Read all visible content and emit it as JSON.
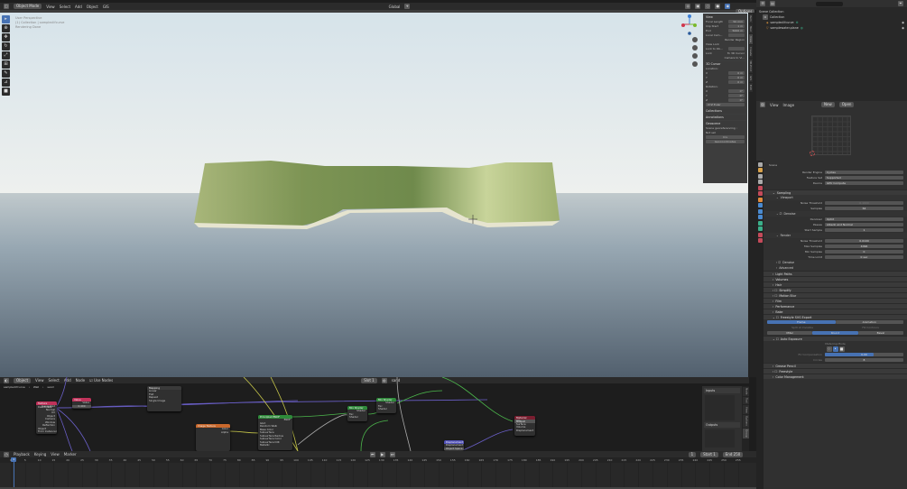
{
  "top_header": {
    "editor_icon": "3d-viewport-icon",
    "mode": "Object Mode",
    "menus": [
      "View",
      "Select",
      "Add",
      "Object",
      "GIS"
    ],
    "transform_orientation": "Global",
    "options": "Options"
  },
  "viewport": {
    "overlay_lines": [
      "User Perspective",
      "(1) Collection | sampleclifcurve",
      "Rendering Done"
    ],
    "tools": [
      "select-box",
      "cursor",
      "move",
      "rotate",
      "scale",
      "transform",
      "annotate",
      "measure",
      "add-cube"
    ]
  },
  "npanel": {
    "view": {
      "title": "View",
      "focal_length_label": "Focal Length",
      "focal_length": "50 mm",
      "clip_start_label": "Clip Start",
      "clip_start": "1 m",
      "end_label": "End",
      "end": "5000 m",
      "local_camera_label": "Local Cam...",
      "render_region": "Render Region",
      "view_lock": "View Lock",
      "lock_to_obj": "Lock to Ob...",
      "lock_label": "Lock",
      "to_3d_cursor": "To 3D Cursor",
      "camera_to_view": "Camera to Vi..."
    },
    "cursor": {
      "title": "3D Cursor",
      "location_label": "Location:",
      "rotation_label": "Rotation:",
      "axes": [
        "X",
        "Y",
        "Z"
      ],
      "loc": [
        "0 m",
        "0 m",
        "0 m"
      ],
      "rot": [
        "0°",
        "0°",
        "0°"
      ],
      "mode": "XYZ Euler"
    },
    "collections": "Collections",
    "annotations": "Annotations",
    "geoscene": {
      "title": "Geoscene",
      "georef_label": "Scene georeferencing :",
      "not_set": "Not set",
      "crs": "Crs",
      "coords_btn": "Geocoordinates"
    },
    "tabs": [
      "Item",
      "Tool",
      "View",
      "Create",
      "3D-Print",
      "GIS",
      "Edit"
    ]
  },
  "outliner": {
    "root": "Scene Collection",
    "collection": "Collection",
    "items": [
      "sampleclifcurve",
      "samplewater.plane"
    ]
  },
  "image_editor": {
    "menus": [
      "View",
      "Image"
    ],
    "new": "New",
    "open": "Open"
  },
  "properties": {
    "scene": "Scene",
    "render_engine_label": "Render Engine",
    "render_engine": "Cycles",
    "feature_set_label": "Feature Set",
    "feature_set": "Supported",
    "device_label": "Device",
    "device": "GPU Compute",
    "sampling": "Sampling",
    "viewport": "Viewport",
    "noise_threshold_label": "Noise Threshold",
    "vp_noise": "0.1000",
    "samples_label": "Samples",
    "vp_samples": "64",
    "denoise": "Denoise",
    "denoiser_label": "Denoiser",
    "denoiser": "OptiX",
    "passes_label": "Passes",
    "passes": "Albedo and Normal",
    "start_sample_label": "Start Sample",
    "start_sample": "1",
    "render": "Render",
    "r_noise": "0.0100",
    "max_samples_label": "Max Samples",
    "max_samples": "4096",
    "min_samples_label": "Min Samples",
    "min_samples": "0",
    "time_limit_label": "Time Limit",
    "time_limit": "0 sec",
    "advanced": "Advanced",
    "panels": [
      "Light Paths",
      "Volumes",
      "Hair",
      "Simplify",
      "Motion Blur",
      "Film",
      "Performance",
      "Bake"
    ],
    "freestyle_svg": "Freestyle SVG Export",
    "frame": "Frame",
    "animation": "Animation",
    "split_invisible": "Split at Invisible",
    "fill_contours": "Fill Contours",
    "join": [
      "Miter",
      "Round",
      "Bevel"
    ],
    "auto_exposure": "Auto Exposure",
    "metering_mode": "Metering Mode",
    "ev_comp_label": "EV Compensation",
    "ev_comp": "0.00",
    "ev_comp_fraction": 0.62,
    "circles_label": "Circles",
    "circles": "8",
    "tail": [
      "Grease Pencil",
      "Freestyle",
      "Color Management"
    ]
  },
  "node_editor": {
    "type": "Object",
    "menus": [
      "View",
      "Select",
      "Add",
      "Node"
    ],
    "use_nodes": "Use Nodes",
    "slot": "Slot 1",
    "material": "sand",
    "breadcrumb": [
      "sampleclifcurve",
      "Wall",
      "sand"
    ],
    "nodes": {
      "texcoord": "Texture Coordinate",
      "texcoord_out": [
        "Generated",
        "Normal",
        "UV",
        "Object",
        "Camera",
        "Window",
        "Reflection"
      ],
      "object_label": "Object",
      "from_instancer": "From Instancer",
      "value": "Value",
      "value_out": "Value",
      "value_num": "0.400",
      "mapping": "Mapping",
      "mapping_rows": [
        "Linear",
        "Flat",
        "Repeat",
        "Single Image"
      ],
      "image": "Image Texture",
      "image_out": [
        "Color",
        "Alpha"
      ],
      "bsdf": "Principled BSDF",
      "bsdf_out": "BSDF",
      "bsdf_rows": [
        "GGX",
        "Random Walk",
        "Base Color",
        "Subsurface",
        "Subsurface Radius",
        "Subsurface Color",
        "Subsurface IOR",
        "Metallic"
      ],
      "mix1": "Mix Shader",
      "mix2": "Mix Shader",
      "mix_in": [
        "Fac",
        "Shader",
        "Shader"
      ],
      "mix_out": "Shader",
      "output": "Material Output",
      "output_target": "All",
      "output_in": [
        "Surface",
        "Volume",
        "Displacement"
      ],
      "disp": "Displacement",
      "disp_out": "Displacement",
      "disp_space": "Object Space"
    },
    "sidebar": {
      "inputs": "Inputs",
      "outputs": "Outputs",
      "tabs": [
        "Node",
        "Tool",
        "View",
        "Options",
        "Group"
      ]
    }
  },
  "timeline": {
    "menus": [
      "Playback",
      "Keying",
      "View",
      "Marker"
    ],
    "current_frame": "1",
    "start_label": "Start",
    "start": "1",
    "end_label": "End",
    "end": "250",
    "ticks": [
      "0",
      "5",
      "10",
      "15",
      "20",
      "25",
      "30",
      "35",
      "40",
      "45",
      "50",
      "55",
      "60",
      "65",
      "70",
      "75",
      "80",
      "85",
      "90",
      "95",
      "100",
      "105",
      "110",
      "115",
      "120",
      "125",
      "130",
      "135",
      "140",
      "145",
      "150",
      "155",
      "160",
      "165",
      "170",
      "175",
      "180",
      "185",
      "190",
      "195",
      "200",
      "205",
      "210",
      "215",
      "220",
      "225",
      "230",
      "235",
      "240",
      "245",
      "250",
      "255"
    ]
  },
  "colors": {
    "accent": "#4772b3",
    "panel": "#303030",
    "bg": "#1d1d1d"
  }
}
